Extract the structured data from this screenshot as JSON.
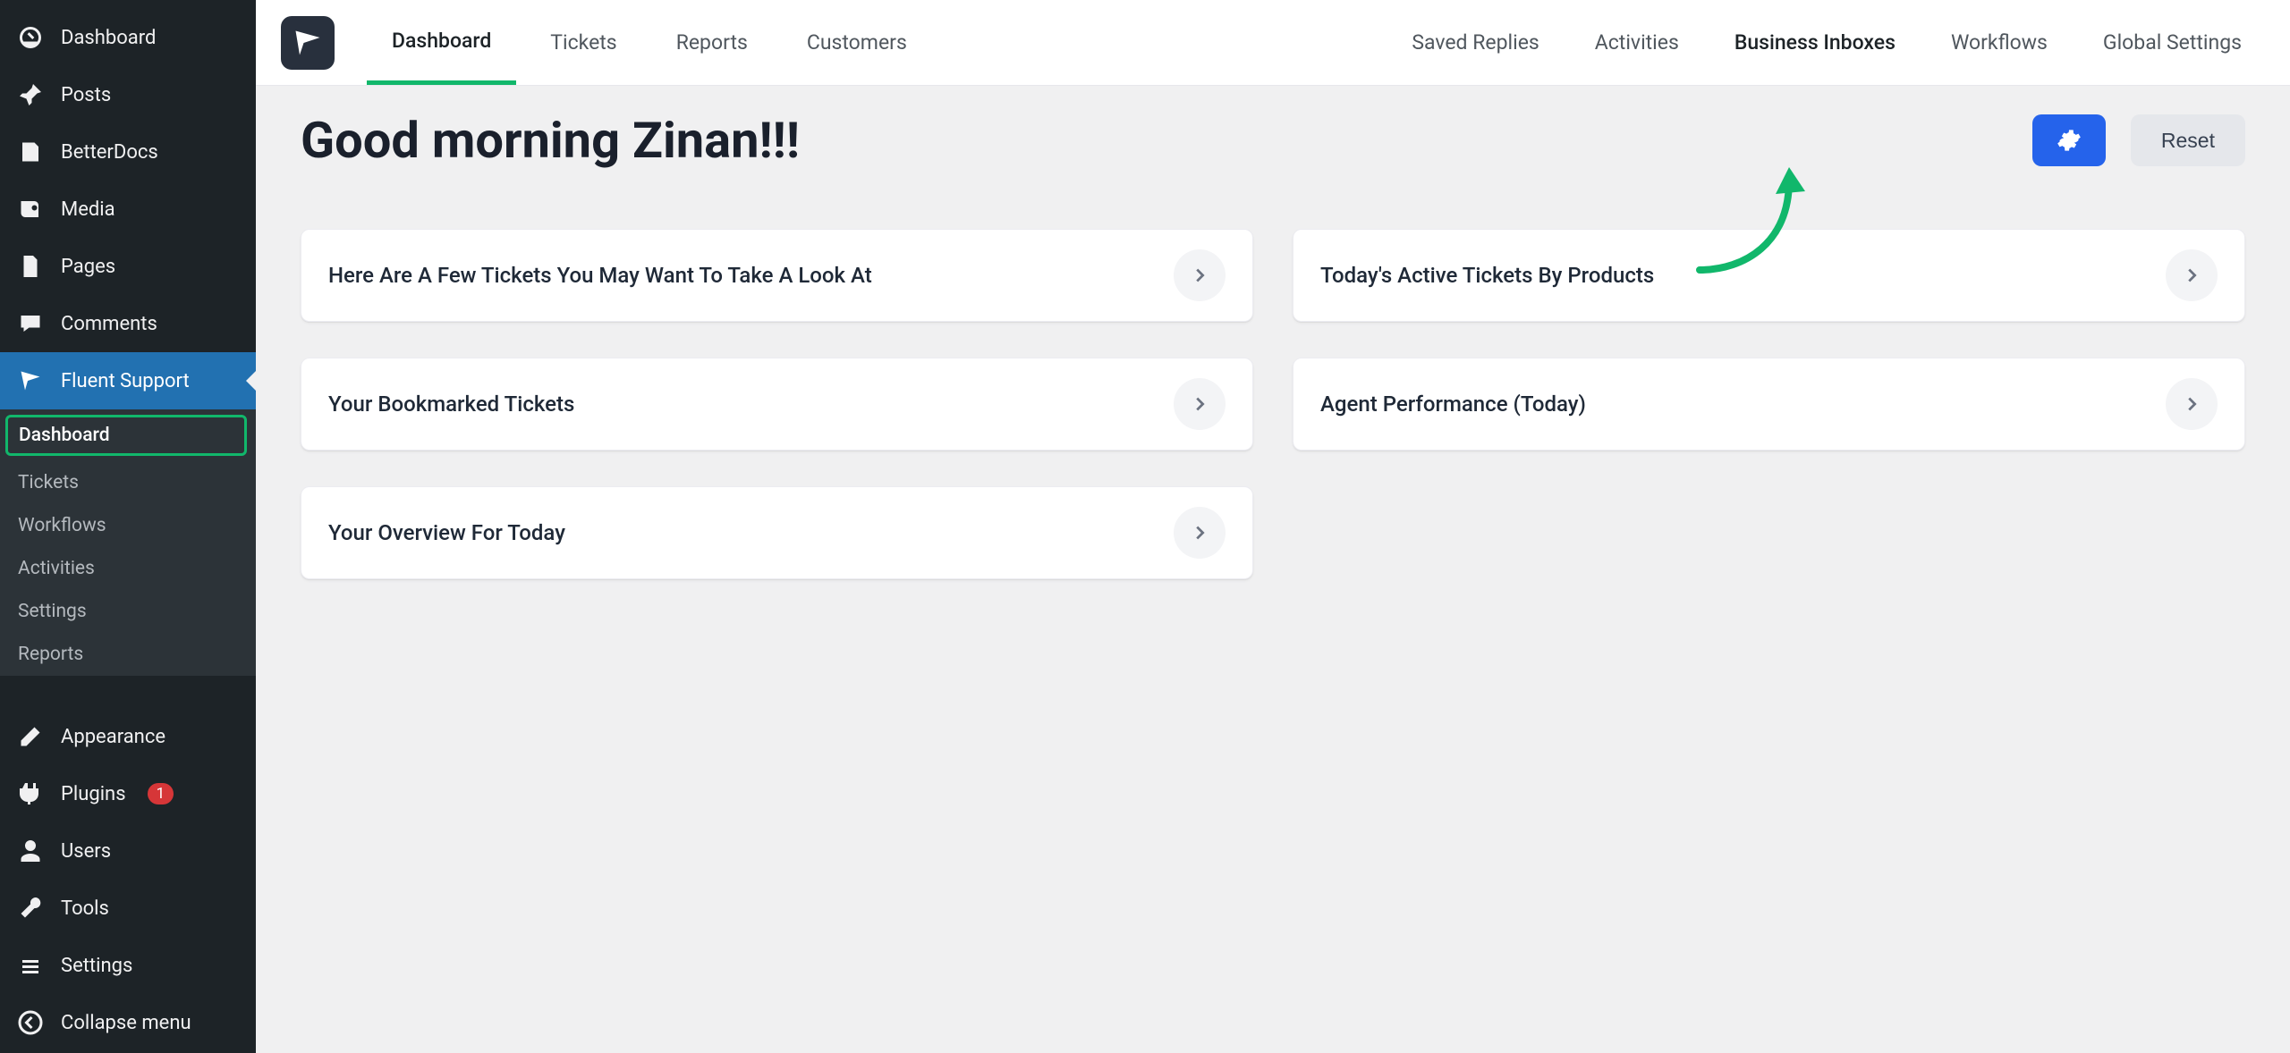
{
  "colors": {
    "accent_green": "#11b76b",
    "primary_blue": "#2563eb",
    "wp_blue": "#2271b1"
  },
  "wp_sidebar": {
    "items": [
      {
        "icon": "dashboard",
        "label": "Dashboard"
      },
      {
        "icon": "pushpin",
        "label": "Posts"
      },
      {
        "icon": "betterdocs",
        "label": "BetterDocs"
      },
      {
        "icon": "media",
        "label": "Media"
      },
      {
        "icon": "page",
        "label": "Pages"
      },
      {
        "icon": "comment",
        "label": "Comments"
      },
      {
        "icon": "fluent",
        "label": "Fluent Support",
        "active": true
      }
    ],
    "fluent_submenu": [
      {
        "label": "Dashboard",
        "current": true
      },
      {
        "label": "Tickets"
      },
      {
        "label": "Workflows"
      },
      {
        "label": "Activities"
      },
      {
        "label": "Settings"
      },
      {
        "label": "Reports"
      }
    ],
    "items_after": [
      {
        "icon": "appearance",
        "label": "Appearance"
      },
      {
        "icon": "plugin",
        "label": "Plugins",
        "badge": "1"
      },
      {
        "icon": "users",
        "label": "Users"
      },
      {
        "icon": "tools",
        "label": "Tools"
      },
      {
        "icon": "settings",
        "label": "Settings"
      },
      {
        "icon": "collapse",
        "label": "Collapse menu"
      }
    ]
  },
  "header": {
    "tabs": [
      {
        "label": "Dashboard",
        "active": true
      },
      {
        "label": "Tickets"
      },
      {
        "label": "Reports"
      },
      {
        "label": "Customers"
      }
    ],
    "links": [
      {
        "label": "Saved Replies"
      },
      {
        "label": "Activities"
      },
      {
        "label": "Business Inboxes",
        "highlight": true
      },
      {
        "label": "Workflows"
      },
      {
        "label": "Global Settings"
      }
    ]
  },
  "greeting": "Good morning Zinan!!!",
  "reset_label": "Reset",
  "cards": [
    {
      "title": "Here Are A Few Tickets You May Want To Take A Look At"
    },
    {
      "title": "Today's Active Tickets By Products"
    },
    {
      "title": "Your Bookmarked Tickets"
    },
    {
      "title": "Agent Performance (Today)"
    },
    {
      "title": "Your Overview For Today"
    }
  ]
}
